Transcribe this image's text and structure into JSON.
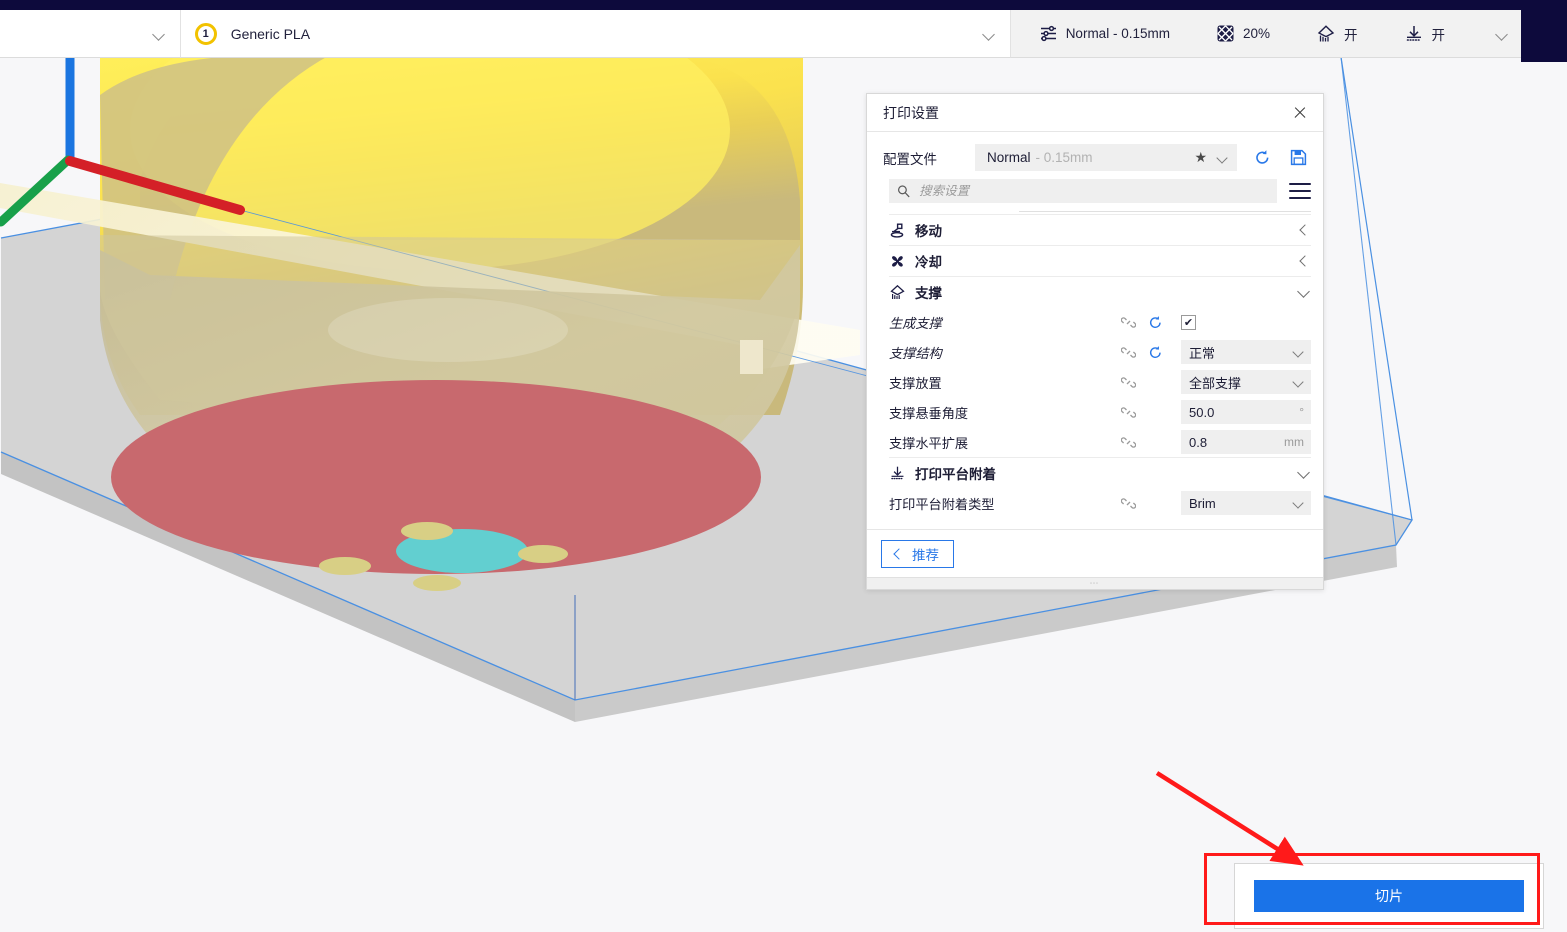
{
  "app": {
    "viewport_name": "3d-print-preview"
  },
  "toolbar": {
    "left_dropdown_icon": "chevron-down-icon",
    "material": {
      "extruder_number": "1",
      "name": "Generic PLA",
      "dropdown_icon": "chevron-down-icon"
    },
    "print_settings": {
      "icon": "sliders-icon",
      "label": "Normal - 0.15mm"
    },
    "infill": {
      "icon": "infill-grid-icon",
      "label": "20%"
    },
    "support": {
      "icon": "support-icon",
      "label": "开"
    },
    "adhesion": {
      "icon": "build-plate-adhesion-icon",
      "label": "开"
    },
    "overflow_icon": "chevron-down-icon"
  },
  "panel": {
    "title": "打印设置",
    "close_icon": "close-icon",
    "profile": {
      "label": "配置文件",
      "name": "Normal",
      "sub": "- 0.15mm",
      "star_icon": "star-icon",
      "dropdown_icon": "chevron-down-icon",
      "reset_icon": "reset-icon",
      "save_icon": "save-icon"
    },
    "search": {
      "icon": "search-icon",
      "placeholder": "搜索设置",
      "value": "",
      "menu_icon": "hamburger-menu-icon"
    },
    "categories": [
      {
        "icon": "move-icon",
        "title": "移动",
        "state_icon": "chevron-left-icon",
        "expanded": false,
        "settings": []
      },
      {
        "icon": "cooling-fan-icon",
        "title": "冷却",
        "state_icon": "chevron-left-icon",
        "expanded": false,
        "settings": []
      },
      {
        "icon": "support-icon",
        "title": "支撑",
        "state_icon": "chevron-down-icon",
        "expanded": true,
        "settings": [
          {
            "label": "生成支撑",
            "italic": true,
            "link_icon": "link-icon",
            "reset_icon": "reset-icon",
            "control": "checkbox",
            "checked": true,
            "value": "",
            "unit": ""
          },
          {
            "label": "支撑结构",
            "italic": true,
            "link_icon": "link-icon",
            "reset_icon": "reset-icon",
            "control": "combo",
            "value": "正常",
            "unit": ""
          },
          {
            "label": "支撑放置",
            "italic": false,
            "link_icon": "link-icon",
            "reset_icon": "",
            "control": "combo",
            "value": "全部支撑",
            "unit": ""
          },
          {
            "label": "支撑悬垂角度",
            "italic": false,
            "link_icon": "link-icon",
            "reset_icon": "",
            "control": "field",
            "value": "50.0",
            "unit": "°"
          },
          {
            "label": "支撑水平扩展",
            "italic": false,
            "link_icon": "link-icon",
            "reset_icon": "",
            "control": "field",
            "value": "0.8",
            "unit": "mm"
          }
        ]
      },
      {
        "icon": "build-plate-adhesion-icon",
        "title": "打印平台附着",
        "state_icon": "chevron-down-icon",
        "expanded": true,
        "settings": [
          {
            "label": "打印平台附着类型",
            "italic": false,
            "link_icon": "link-icon",
            "reset_icon": "",
            "control": "combo",
            "value": "Brim",
            "unit": ""
          }
        ]
      }
    ],
    "footer": {
      "recommended_label": "推荐",
      "back_icon": "chevron-left-icon"
    },
    "grip": "⋯"
  },
  "action": {
    "slice_label": "切片"
  },
  "colors": {
    "accent_blue": "#1a73e8",
    "navy": "#0d0a3c",
    "annotation_red": "#ff1a1a",
    "model_yellow": "#f5e050",
    "support_red": "#c8696e",
    "support_teal": "#62cfd0",
    "axis_x": "#d42027",
    "axis_y": "#18a04a",
    "axis_z": "#1b75e0",
    "plate_gray": "#cfcfcf"
  }
}
